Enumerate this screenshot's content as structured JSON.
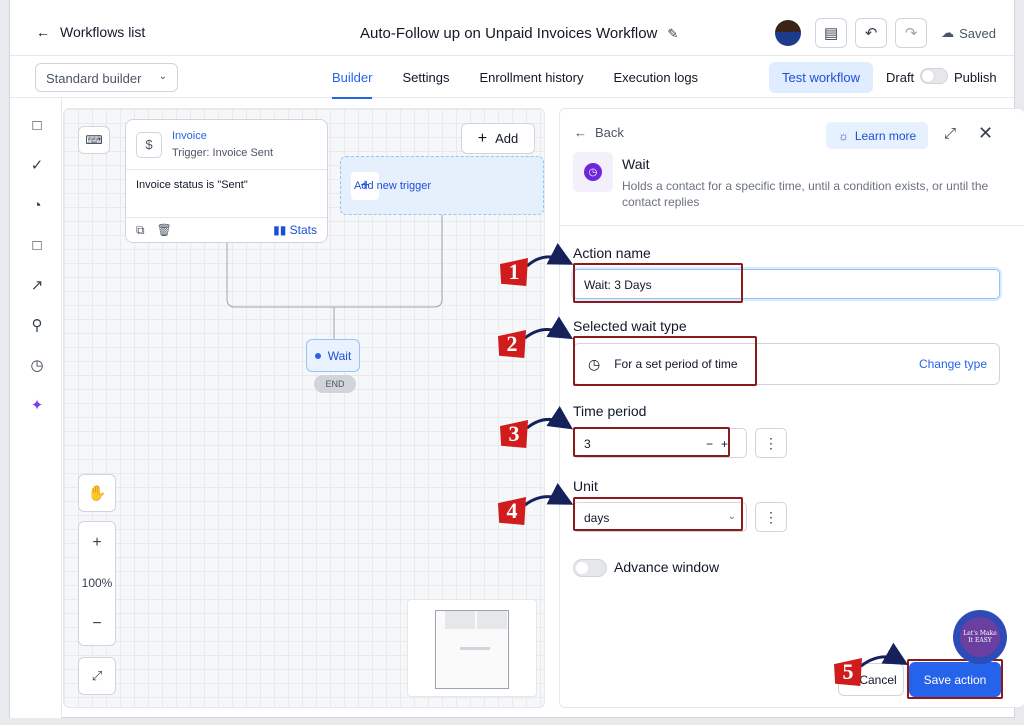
{
  "header": {
    "back_label": "Workflows list",
    "title": "Auto-Follow up on Unpaid Invoices Workflow",
    "saved_label": "Saved"
  },
  "toolbar": {
    "builder_select": "Standard builder",
    "tabs": [
      {
        "label": "Builder",
        "active": true
      },
      {
        "label": "Settings",
        "active": false
      },
      {
        "label": "Enrollment history",
        "active": false
      },
      {
        "label": "Execution logs",
        "active": false
      }
    ],
    "test_label": "Test workflow",
    "draft_label": "Draft",
    "publish_label": "Publish"
  },
  "canvas": {
    "add_label": "Add",
    "trigger_node": {
      "title": "Invoice",
      "subtitle": "Trigger: Invoice Sent",
      "condition": "Invoice status is \"Sent\"",
      "stats_label": "Stats"
    },
    "add_trigger_label": "Add new trigger",
    "wait_node_label": "Wait",
    "end_label": "END",
    "zoom_label": "100%"
  },
  "panel": {
    "back_label": "Back",
    "learn_more": "Learn more",
    "title": "Wait",
    "description": "Holds a contact for a specific time, until a condition exists, or until the contact replies",
    "action_name_label": "Action name",
    "action_name_value": "Wait: 3 Days",
    "wait_type_label": "Selected wait type",
    "wait_type_value": "For a set period of time",
    "change_type": "Change type",
    "time_period_label": "Time period",
    "time_period_value": "3",
    "unit_label": "Unit",
    "unit_value": "days",
    "advance_window_label": "Advance window",
    "cancel_label": "Cancel",
    "save_label": "Save action"
  },
  "annotations": {
    "steps": [
      "1",
      "2",
      "3",
      "4",
      "5"
    ],
    "color": "#d01c1c",
    "logo_text": "Let's Make It EASY"
  }
}
